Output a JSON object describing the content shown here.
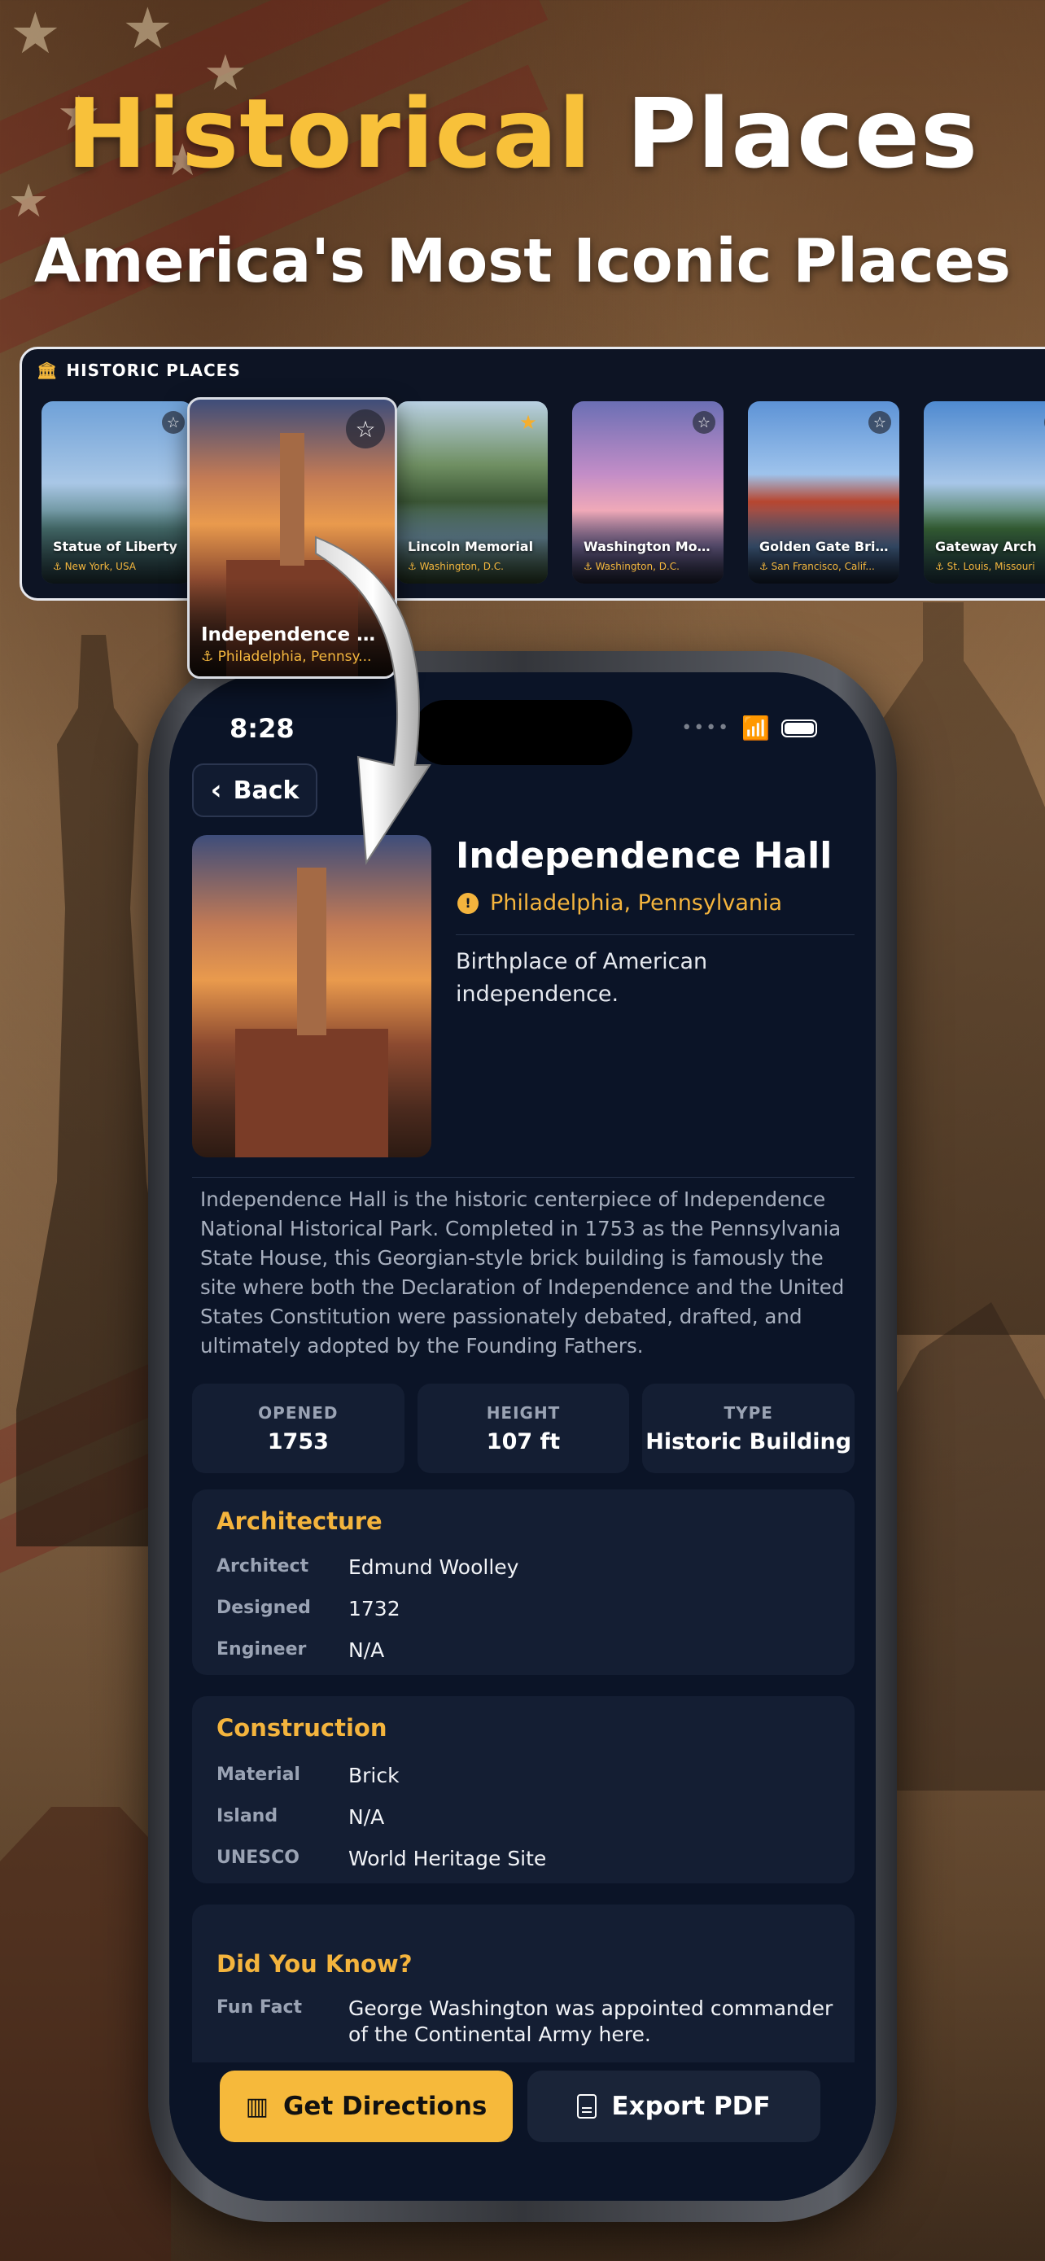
{
  "hero": {
    "title_highlight": "Historical",
    "title_rest": " Places",
    "subtitle": "America's Most Iconic Places"
  },
  "carousel": {
    "header": "HISTORIC PLACES",
    "header_icon": "landmark-icon",
    "cards": [
      {
        "name": "Statue of Liberty",
        "location": "New York, USA",
        "favorite": false
      },
      {
        "name": "Lincoln Memorial",
        "location": "Washington, D.C.",
        "favorite": true
      },
      {
        "name": "Washington Mon...",
        "location": "Washington, D.C.",
        "favorite": false
      },
      {
        "name": "Golden Gate Bridge",
        "location": "San Francisco, Calif...",
        "favorite": false
      },
      {
        "name": "Gateway Arch",
        "location": "St. Louis, Missouri",
        "favorite": false
      }
    ],
    "featured": {
      "name": "Independence H...",
      "location": "Philadelphia, Pennsy...",
      "favorite": false
    }
  },
  "status_bar": {
    "time": "8:28"
  },
  "detail": {
    "back_label": "Back",
    "title": "Independence Hall",
    "location": "Philadelphia, Pennsylvania",
    "tagline": "Birthplace of American independence.",
    "description": "Independence Hall is the historic centerpiece of Independence National Historical Park. Completed in 1753 as the Pennsylvania State House, this Georgian-style brick building is famously the site where both the Declaration of Independence and the United States Constitution were passionately debated, drafted, and ultimately adopted by the Founding Fathers.",
    "stats": [
      {
        "label": "OPENED",
        "value": "1753"
      },
      {
        "label": "HEIGHT",
        "value": "107 ft"
      },
      {
        "label": "TYPE",
        "value": "Historic Building"
      }
    ],
    "architecture": {
      "title": "Architecture",
      "rows": [
        {
          "key": "Architect",
          "value": "Edmund Woolley"
        },
        {
          "key": "Designed",
          "value": "1732"
        },
        {
          "key": "Engineer",
          "value": "N/A"
        }
      ]
    },
    "construction": {
      "title": "Construction",
      "rows": [
        {
          "key": "Material",
          "value": "Brick"
        },
        {
          "key": "Island",
          "value": "N/A"
        },
        {
          "key": "UNESCO",
          "value": "World Heritage Site"
        }
      ]
    },
    "did_you_know": {
      "title": "Did You Know?",
      "rows": [
        {
          "key": "Fun Fact",
          "value": "George Washington was appointed commander of the Continental Army here."
        }
      ]
    }
  },
  "actions": {
    "directions_label": "Get Directions",
    "export_label": "Export PDF"
  },
  "colors": {
    "accent_gold": "#f4b43d",
    "screen_bg": "#0b1427",
    "card_bg": "#141e33"
  }
}
